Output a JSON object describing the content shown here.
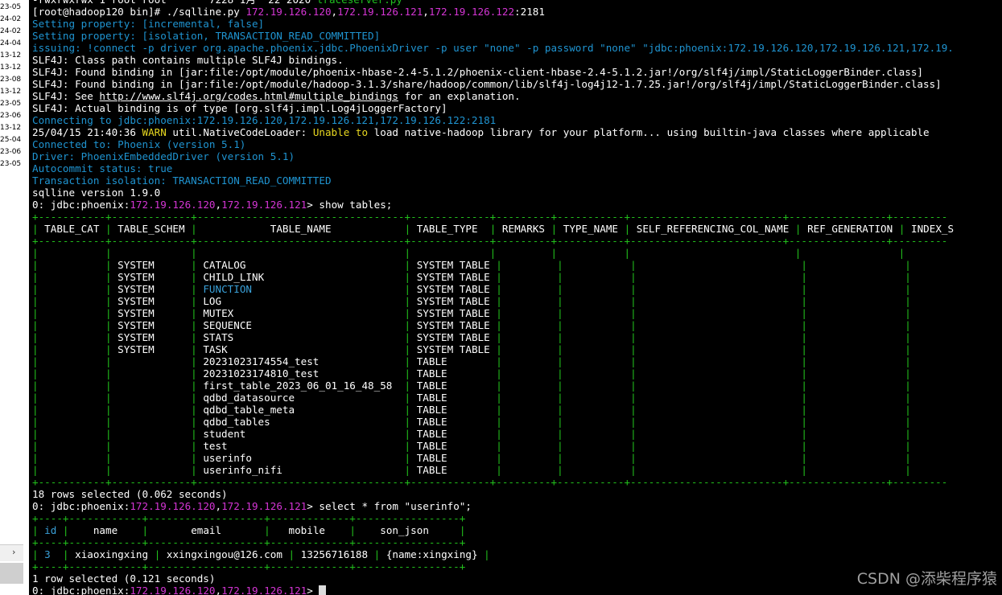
{
  "sidebar": {
    "items": [
      "23-05",
      "24-02",
      "24-02",
      "24-04",
      "13-12",
      "13-12",
      "23-08",
      "13-12",
      "23-05",
      "23-06",
      "13-12",
      "25-04",
      "23-06",
      "23-05"
    ]
  },
  "scroll": {
    "arrow": "›"
  },
  "watermark": "CSDN @添柴程序猿",
  "terminal": {
    "lines": [
      [
        {
          "t": "-rwxrwxrwx 1 root root       7228 1月  22 2020 ",
          "c": "wht"
        },
        {
          "t": "traceserver.py",
          "c": "gr"
        }
      ],
      [
        {
          "t": "[root@hadoop120 bin]# ./sqlline.py ",
          "c": "wht"
        },
        {
          "t": "172.19.126.120",
          "c": "mag"
        },
        {
          "t": ",",
          "c": "wht"
        },
        {
          "t": "172.19.126.121",
          "c": "mag"
        },
        {
          "t": ",",
          "c": "wht"
        },
        {
          "t": "172.19.126.122",
          "c": "mag"
        },
        {
          "t": ":2181",
          "c": "wht"
        }
      ],
      [
        {
          "t": "Setting property: [incremental, false]",
          "c": "blue"
        }
      ],
      [
        {
          "t": "Setting property: [isolation, TRANSACTION_READ_COMMITTED]",
          "c": "blue"
        }
      ],
      [
        {
          "t": "issuing: !connect -p driver org.apache.phoenix.jdbc.PhoenixDriver -p user \"none\" -p password \"none\" \"jdbc:phoenix:172.19.126.120,172.19.126.121,172.19.",
          "c": "blue"
        }
      ],
      [
        {
          "t": "SLF4J: Class path contains multiple SLF4J bindings.",
          "c": "wht"
        }
      ],
      [
        {
          "t": "SLF4J: Found binding in [jar:file:/opt/module/phoenix-hbase-2.4-5.1.2/phoenix-client-hbase-2.4-5.1.2.jar!/org/slf4j/impl/StaticLoggerBinder.class]",
          "c": "wht"
        }
      ],
      [
        {
          "t": "SLF4J: Found binding in [jar:file:/opt/module/hadoop-3.1.3/share/hadoop/common/lib/slf4j-log4j12-1.7.25.jar!/org/slf4j/impl/StaticLoggerBinder.class]",
          "c": "wht"
        }
      ],
      [
        {
          "t": "SLF4J: See ",
          "c": "wht"
        },
        {
          "t": "http://www.slf4j.org/codes.html#multiple_bindings",
          "c": "wht u"
        },
        {
          "t": " for an explanation.",
          "c": "wht"
        }
      ],
      [
        {
          "t": "SLF4J: Actual binding is of type [org.slf4j.impl.Log4jLoggerFactory]",
          "c": "wht"
        }
      ],
      [
        {
          "t": "Connecting to jdbc:phoenix:172.19.126.120,172.19.126.121,172.19.126.122:2181",
          "c": "blue"
        }
      ],
      [
        {
          "t": "25/04/15 21:40:36 ",
          "c": "wht"
        },
        {
          "t": "WARN",
          "c": "yel"
        },
        {
          "t": " util.NativeCodeLoader: ",
          "c": "wht"
        },
        {
          "t": "Unable",
          "c": "yel"
        },
        {
          "t": " ",
          "c": "wht"
        },
        {
          "t": "to",
          "c": "yel"
        },
        {
          "t": " load native-hadoop library for your platform... using builtin-java classes where applicable",
          "c": "wht"
        }
      ],
      [
        {
          "t": "Connected to: Phoenix (version 5.1)",
          "c": "blue"
        }
      ],
      [
        {
          "t": "Driver: PhoenixEmbeddedDriver (version 5.1)",
          "c": "blue"
        }
      ],
      [
        {
          "t": "Autocommit status: true",
          "c": "blue"
        }
      ],
      [
        {
          "t": "Transaction isolation: TRANSACTION_READ_COMMITTED",
          "c": "blue"
        }
      ],
      [
        {
          "t": "sqlline version 1.9.0",
          "c": "wht"
        }
      ],
      [
        {
          "t": "0: jdbc:phoenix:",
          "c": "wht"
        },
        {
          "t": "172.19.126.120",
          "c": "mag"
        },
        {
          "t": ",",
          "c": "wht"
        },
        {
          "t": "172.19.126.121",
          "c": "mag"
        },
        {
          "t": "> show tables;",
          "c": "wht"
        }
      ],
      [
        {
          "t": "+-----------+-------------+----------------------------------+-------------+---------+-----------+-------------------------+----------------+---------",
          "c": "green"
        }
      ],
      [
        {
          "t": "|",
          "c": "green"
        },
        {
          "t": " TABLE_CAT ",
          "c": "wht"
        },
        {
          "t": "|",
          "c": "green"
        },
        {
          "t": " TABLE_SCHEM ",
          "c": "wht"
        },
        {
          "t": "|",
          "c": "green"
        },
        {
          "t": "            TABLE_NAME            ",
          "c": "wht"
        },
        {
          "t": "|",
          "c": "green"
        },
        {
          "t": " TABLE_TYPE  ",
          "c": "wht"
        },
        {
          "t": "|",
          "c": "green"
        },
        {
          "t": " REMARKS ",
          "c": "wht"
        },
        {
          "t": "|",
          "c": "green"
        },
        {
          "t": " TYPE_NAME ",
          "c": "wht"
        },
        {
          "t": "|",
          "c": "green"
        },
        {
          "t": " SELF_REFERENCING_COL_NAME ",
          "c": "wht"
        },
        {
          "t": "|",
          "c": "green"
        },
        {
          "t": " REF_GENERATION ",
          "c": "wht"
        },
        {
          "t": "|",
          "c": "green"
        },
        {
          "t": " INDEX_S",
          "c": "wht"
        }
      ],
      [
        {
          "t": "+-----------+-------------+----------------------------------+-------------+---------+-----------+-------------------------+----------------+---------",
          "c": "green"
        }
      ],
      [
        {
          "t": "|           |             |                                  |             |         |           |                           |                |         ",
          "c": "green"
        }
      ],
      [
        {
          "t": "|           | ",
          "c": "green"
        },
        {
          "t": "SYSTEM",
          "c": "wht"
        },
        {
          "t": "      | ",
          "c": "green"
        },
        {
          "t": "CATALOG",
          "c": "wht"
        },
        {
          "t": "                          | ",
          "c": "green"
        },
        {
          "t": "SYSTEM TABLE",
          "c": "wht"
        },
        {
          "t": " |         |           |                           |                |         ",
          "c": "green"
        }
      ],
      [
        {
          "t": "|           | ",
          "c": "green"
        },
        {
          "t": "SYSTEM",
          "c": "wht"
        },
        {
          "t": "      | ",
          "c": "green"
        },
        {
          "t": "CHILD_LINK",
          "c": "wht"
        },
        {
          "t": "                       | ",
          "c": "green"
        },
        {
          "t": "SYSTEM TABLE",
          "c": "wht"
        },
        {
          "t": " |         |           |                           |                |         ",
          "c": "green"
        }
      ],
      [
        {
          "t": "|           | ",
          "c": "green"
        },
        {
          "t": "SYSTEM",
          "c": "wht"
        },
        {
          "t": "      | ",
          "c": "green"
        },
        {
          "t": "FUNCTION",
          "c": "cyan"
        },
        {
          "t": "                         | ",
          "c": "green"
        },
        {
          "t": "SYSTEM TABLE",
          "c": "wht"
        },
        {
          "t": " |         |           |                           |                |         ",
          "c": "green"
        }
      ],
      [
        {
          "t": "|           | ",
          "c": "green"
        },
        {
          "t": "SYSTEM",
          "c": "wht"
        },
        {
          "t": "      | ",
          "c": "green"
        },
        {
          "t": "LOG",
          "c": "wht"
        },
        {
          "t": "                              | ",
          "c": "green"
        },
        {
          "t": "SYSTEM TABLE",
          "c": "wht"
        },
        {
          "t": " |         |           |                           |                |         ",
          "c": "green"
        }
      ],
      [
        {
          "t": "|           | ",
          "c": "green"
        },
        {
          "t": "SYSTEM",
          "c": "wht"
        },
        {
          "t": "      | ",
          "c": "green"
        },
        {
          "t": "MUTEX",
          "c": "wht"
        },
        {
          "t": "                            | ",
          "c": "green"
        },
        {
          "t": "SYSTEM TABLE",
          "c": "wht"
        },
        {
          "t": " |         |           |                           |                |         ",
          "c": "green"
        }
      ],
      [
        {
          "t": "|           | ",
          "c": "green"
        },
        {
          "t": "SYSTEM",
          "c": "wht"
        },
        {
          "t": "      | ",
          "c": "green"
        },
        {
          "t": "SEQUENCE",
          "c": "wht"
        },
        {
          "t": "                         | ",
          "c": "green"
        },
        {
          "t": "SYSTEM TABLE",
          "c": "wht"
        },
        {
          "t": " |         |           |                           |                |         ",
          "c": "green"
        }
      ],
      [
        {
          "t": "|           | ",
          "c": "green"
        },
        {
          "t": "SYSTEM",
          "c": "wht"
        },
        {
          "t": "      | ",
          "c": "green"
        },
        {
          "t": "STATS",
          "c": "wht"
        },
        {
          "t": "                            | ",
          "c": "green"
        },
        {
          "t": "SYSTEM TABLE",
          "c": "wht"
        },
        {
          "t": " |         |           |                           |                |         ",
          "c": "green"
        }
      ],
      [
        {
          "t": "|           | ",
          "c": "green"
        },
        {
          "t": "SYSTEM",
          "c": "wht"
        },
        {
          "t": "      | ",
          "c": "green"
        },
        {
          "t": "TASK",
          "c": "wht"
        },
        {
          "t": "                             | ",
          "c": "green"
        },
        {
          "t": "SYSTEM TABLE",
          "c": "wht"
        },
        {
          "t": " |         |           |                           |                |         ",
          "c": "green"
        }
      ],
      [
        {
          "t": "|           |             | ",
          "c": "green"
        },
        {
          "t": "20231023174554_test",
          "c": "wht"
        },
        {
          "t": "              | ",
          "c": "green"
        },
        {
          "t": "TABLE",
          "c": "wht"
        },
        {
          "t": "        |         |           |                           |                |         ",
          "c": "green"
        }
      ],
      [
        {
          "t": "|           |             | ",
          "c": "green"
        },
        {
          "t": "20231023174810_test",
          "c": "wht"
        },
        {
          "t": "              | ",
          "c": "green"
        },
        {
          "t": "TABLE",
          "c": "wht"
        },
        {
          "t": "        |         |           |                           |                |         ",
          "c": "green"
        }
      ],
      [
        {
          "t": "|           |             | ",
          "c": "green"
        },
        {
          "t": "first_table_2023_06_01_16_48_58",
          "c": "wht"
        },
        {
          "t": "  | ",
          "c": "green"
        },
        {
          "t": "TABLE",
          "c": "wht"
        },
        {
          "t": "        |         |           |                           |                |         ",
          "c": "green"
        }
      ],
      [
        {
          "t": "|           |             | ",
          "c": "green"
        },
        {
          "t": "qdbd_datasource",
          "c": "wht"
        },
        {
          "t": "                  | ",
          "c": "green"
        },
        {
          "t": "TABLE",
          "c": "wht"
        },
        {
          "t": "        |         |           |                           |                |         ",
          "c": "green"
        }
      ],
      [
        {
          "t": "|           |             | ",
          "c": "green"
        },
        {
          "t": "qdbd_table_meta",
          "c": "wht"
        },
        {
          "t": "                  | ",
          "c": "green"
        },
        {
          "t": "TABLE",
          "c": "wht"
        },
        {
          "t": "        |         |           |                           |                |         ",
          "c": "green"
        }
      ],
      [
        {
          "t": "|           |             | ",
          "c": "green"
        },
        {
          "t": "qdbd_tables",
          "c": "wht"
        },
        {
          "t": "                      | ",
          "c": "green"
        },
        {
          "t": "TABLE",
          "c": "wht"
        },
        {
          "t": "        |         |           |                           |                |         ",
          "c": "green"
        }
      ],
      [
        {
          "t": "|           |             | ",
          "c": "green"
        },
        {
          "t": "student",
          "c": "wht"
        },
        {
          "t": "                          | ",
          "c": "green"
        },
        {
          "t": "TABLE",
          "c": "wht"
        },
        {
          "t": "        |         |           |                           |                |         ",
          "c": "green"
        }
      ],
      [
        {
          "t": "|           |             | ",
          "c": "green"
        },
        {
          "t": "test",
          "c": "wht"
        },
        {
          "t": "                             | ",
          "c": "green"
        },
        {
          "t": "TABLE",
          "c": "wht"
        },
        {
          "t": "        |         |           |                           |                |         ",
          "c": "green"
        }
      ],
      [
        {
          "t": "|           |             | ",
          "c": "green"
        },
        {
          "t": "userinfo",
          "c": "wht"
        },
        {
          "t": "                         | ",
          "c": "green"
        },
        {
          "t": "TABLE",
          "c": "wht"
        },
        {
          "t": "        |         |           |                           |                |         ",
          "c": "green"
        }
      ],
      [
        {
          "t": "|           |             | ",
          "c": "green"
        },
        {
          "t": "userinfo_nifi",
          "c": "wht"
        },
        {
          "t": "                    | ",
          "c": "green"
        },
        {
          "t": "TABLE",
          "c": "wht"
        },
        {
          "t": "        |         |           |                           |                |         ",
          "c": "green"
        }
      ],
      [
        {
          "t": "+-----------+-------------+----------------------------------+-------------+---------+-----------+-------------------------+----------------+---------",
          "c": "green"
        }
      ],
      [
        {
          "t": "18 rows selected (0.062 seconds)",
          "c": "wht"
        }
      ],
      [
        {
          "t": "0: jdbc:phoenix:",
          "c": "wht"
        },
        {
          "t": "172.19.126.120",
          "c": "mag"
        },
        {
          "t": ",",
          "c": "wht"
        },
        {
          "t": "172.19.126.121",
          "c": "mag"
        },
        {
          "t": "> select * from \"userinfo\";",
          "c": "wht"
        }
      ],
      [
        {
          "t": "+----+------------+-------------------+-------------+-----------------+",
          "c": "green"
        }
      ],
      [
        {
          "t": "| ",
          "c": "green"
        },
        {
          "t": "id",
          "c": "cyan"
        },
        {
          "t": " |    ",
          "c": "green"
        },
        {
          "t": "name",
          "c": "wht"
        },
        {
          "t": "    |       ",
          "c": "green"
        },
        {
          "t": "email",
          "c": "wht"
        },
        {
          "t": "       |   ",
          "c": "green"
        },
        {
          "t": "mobile",
          "c": "wht"
        },
        {
          "t": "    |    ",
          "c": "green"
        },
        {
          "t": "son_json",
          "c": "wht"
        },
        {
          "t": "     |",
          "c": "green"
        }
      ],
      [
        {
          "t": "+----+------------+-------------------+-------------+-----------------+",
          "c": "green"
        }
      ],
      [
        {
          "t": "| ",
          "c": "green"
        },
        {
          "t": "3",
          "c": "cyan"
        },
        {
          "t": "  | ",
          "c": "green"
        },
        {
          "t": "xiaoxingxing",
          "c": "wht"
        },
        {
          "t": " | ",
          "c": "green"
        },
        {
          "t": "xxingxingou@126.com",
          "c": "wht"
        },
        {
          "t": " | ",
          "c": "green"
        },
        {
          "t": "13256716188",
          "c": "wht"
        },
        {
          "t": " | ",
          "c": "green"
        },
        {
          "t": "{name:xingxing}",
          "c": "wht"
        },
        {
          "t": " |",
          "c": "green"
        }
      ],
      [
        {
          "t": "+----+------------+-------------------+-------------+-----------------+",
          "c": "green"
        }
      ],
      [
        {
          "t": "1 row selected (0.121 seconds)",
          "c": "wht"
        }
      ],
      [
        {
          "t": "0: jdbc:phoenix:",
          "c": "wht"
        },
        {
          "t": "172.19.126.120",
          "c": "mag"
        },
        {
          "t": ",",
          "c": "wht"
        },
        {
          "t": "172.19.126.121",
          "c": "mag"
        },
        {
          "t": "> ",
          "c": "wht"
        }
      ]
    ]
  }
}
